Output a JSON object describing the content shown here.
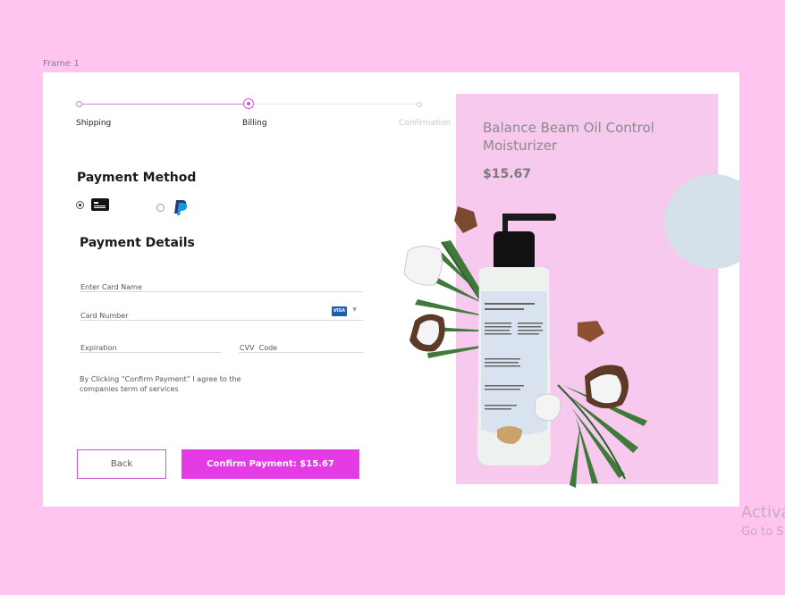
{
  "frame_label": "Frame 1",
  "stepper": {
    "steps": [
      "Shipping",
      "Billing",
      "Confirmation"
    ],
    "current": "Billing"
  },
  "payment_method": {
    "title": "Payment Method",
    "options": [
      {
        "icon": "credit-card-icon",
        "selected": true
      },
      {
        "icon": "paypal-icon",
        "selected": false
      }
    ]
  },
  "payment_details": {
    "title": "Payment Details",
    "card_name_placeholder": "Enter Card Name",
    "card_number_placeholder": "Card Number",
    "card_brand": "VISA",
    "expiration_placeholder": "Expiration",
    "cvv_placeholder": "CVV  Code"
  },
  "terms_text": "By Clicking “Confirm Payment” I agree to the companies term of services",
  "buttons": {
    "back": "Back",
    "confirm": "Confirm Payment: $15.67"
  },
  "product": {
    "name": "Balance Beam Oil Control Moisturizer",
    "price": "$15.67"
  },
  "watermark": {
    "line1": "Activa",
    "line2": "Go to S"
  },
  "colors": {
    "background": "#fec5f0",
    "accent": "#e43be6",
    "panel": "#f7c9ef",
    "circle": "#d4e1e8"
  }
}
